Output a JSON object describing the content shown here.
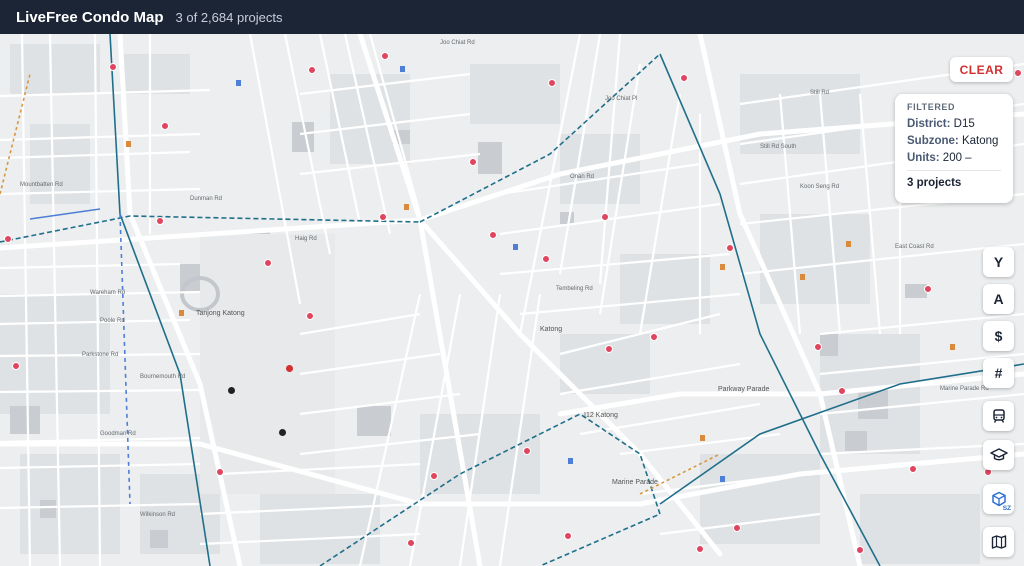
{
  "header": {
    "title": "LiveFree Condo Map",
    "count_text": "3 of 2,684 projects"
  },
  "controls": {
    "clear_label": "CLEAR"
  },
  "filter_panel": {
    "heading": "FILTERED",
    "district_label": "District:",
    "district_value": "D15",
    "subzone_label": "Subzone:",
    "subzone_value": "Katong",
    "units_label": "Units:",
    "units_value": "200 –",
    "result_text": "3 projects"
  },
  "toolbar": {
    "year_label": "Y",
    "area_label": "A",
    "price_label": "$",
    "units_label": "#",
    "sz_label": "SZ"
  },
  "map": {
    "street_labels": [
      "Joo Chiat Rd",
      "Still Rd",
      "East Coast Rd",
      "Marine Parade Rd",
      "Tembeling Rd",
      "Onan Rd",
      "Dunman Rd",
      "Haig Rd",
      "Joo Chiat Pl",
      "Koon Seng Rd",
      "Still Rd South",
      "Wilkinson Rd",
      "Goodman Rd",
      "Bournemouth Rd",
      "Parkstone Rd",
      "Poole Rd",
      "Wareham Rd",
      "Mountbatten Rd"
    ],
    "place_labels": [
      "Tanjong Katong",
      "Katong",
      "Marine Parade",
      "I12 Katong",
      "Parkway Parade"
    ],
    "colors": {
      "major_road": "#ffffff",
      "transit_line": "#1f6f8b",
      "pin_selected": "#d32f2f",
      "pin_other": "#222222",
      "poi": "#e0455f"
    }
  }
}
